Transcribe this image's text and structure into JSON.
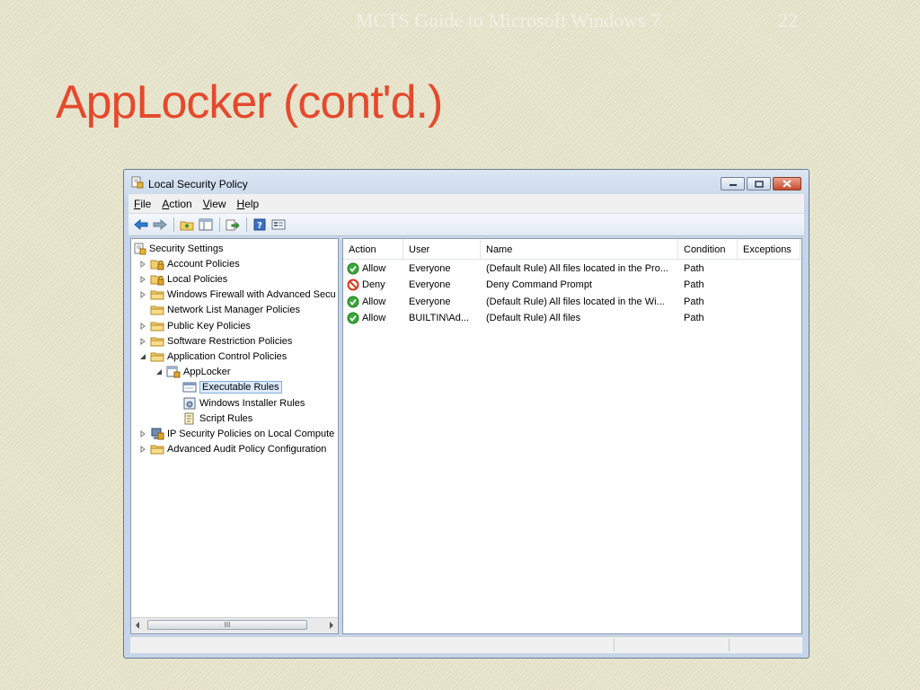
{
  "slide": {
    "course": "MCTS Guide to Microsoft Windows 7",
    "page_number": "22",
    "title": "AppLocker (cont'd.)"
  },
  "window": {
    "title": "Local Security Policy",
    "icon": "security-policy-icon",
    "menu": [
      {
        "key": "F",
        "rest": "ile"
      },
      {
        "key": "A",
        "rest": "ction"
      },
      {
        "key": "V",
        "rest": "iew"
      },
      {
        "key": "H",
        "rest": "elp"
      }
    ],
    "toolbar_icons": [
      "back-arrow-icon",
      "forward-arrow-icon",
      "up-folder-icon",
      "show-hide-tree-icon",
      "export-list-icon",
      "help-icon",
      "properties-icon"
    ]
  },
  "tree": {
    "items": [
      {
        "label": "Security Settings",
        "level": 0,
        "expander": "none",
        "icon": "security-settings-icon"
      },
      {
        "label": "Account Policies",
        "level": 1,
        "expander": "collapsed",
        "icon": "locked-folder-icon"
      },
      {
        "label": "Local Policies",
        "level": 1,
        "expander": "collapsed",
        "icon": "locked-folder-icon"
      },
      {
        "label": "Windows Firewall with Advanced Secu",
        "level": 1,
        "expander": "collapsed",
        "icon": "folder-icon"
      },
      {
        "label": "Network List Manager Policies",
        "level": 1,
        "expander": "none",
        "icon": "folder-icon"
      },
      {
        "label": "Public Key Policies",
        "level": 1,
        "expander": "collapsed",
        "icon": "folder-icon"
      },
      {
        "label": "Software Restriction Policies",
        "level": 1,
        "expander": "collapsed",
        "icon": "folder-icon"
      },
      {
        "label": "Application Control Policies",
        "level": 1,
        "expander": "expanded",
        "icon": "folder-icon"
      },
      {
        "label": "AppLocker",
        "level": 2,
        "expander": "expanded",
        "icon": "applocker-icon"
      },
      {
        "label": "Executable Rules",
        "level": 3,
        "expander": "none",
        "icon": "executable-rules-icon",
        "selected": true
      },
      {
        "label": "Windows Installer Rules",
        "level": 3,
        "expander": "none",
        "icon": "installer-rules-icon"
      },
      {
        "label": "Script Rules",
        "level": 3,
        "expander": "none",
        "icon": "script-rules-icon"
      },
      {
        "label": "IP Security Policies on Local Compute",
        "level": 1,
        "expander": "collapsed",
        "icon": "ip-security-icon"
      },
      {
        "label": "Advanced Audit Policy Configuration",
        "level": 1,
        "expander": "collapsed",
        "icon": "folder-icon"
      }
    ]
  },
  "list": {
    "columns": [
      "Action",
      "User",
      "Name",
      "Condition",
      "Exceptions"
    ],
    "rows": [
      {
        "action": "Allow",
        "status": "allow",
        "user": "Everyone",
        "name": "(Default Rule) All files located in the Pro...",
        "condition": "Path",
        "exceptions": ""
      },
      {
        "action": "Deny",
        "status": "deny",
        "user": "Everyone",
        "name": "Deny Command Prompt",
        "condition": "Path",
        "exceptions": ""
      },
      {
        "action": "Allow",
        "status": "allow",
        "user": "Everyone",
        "name": "(Default Rule) All files located in the Wi...",
        "condition": "Path",
        "exceptions": ""
      },
      {
        "action": "Allow",
        "status": "allow",
        "user": "BUILTIN\\Ad...",
        "name": "(Default Rule) All files",
        "condition": "Path",
        "exceptions": ""
      }
    ]
  },
  "scrollbar": {
    "thumb_grip": "III"
  },
  "colors": {
    "title_red": "#e5492c",
    "allow_green": "#3aa83a",
    "deny_red": "#d9341c",
    "folder_yellow": "#f2cf6b",
    "selection": "#dcebfc"
  }
}
